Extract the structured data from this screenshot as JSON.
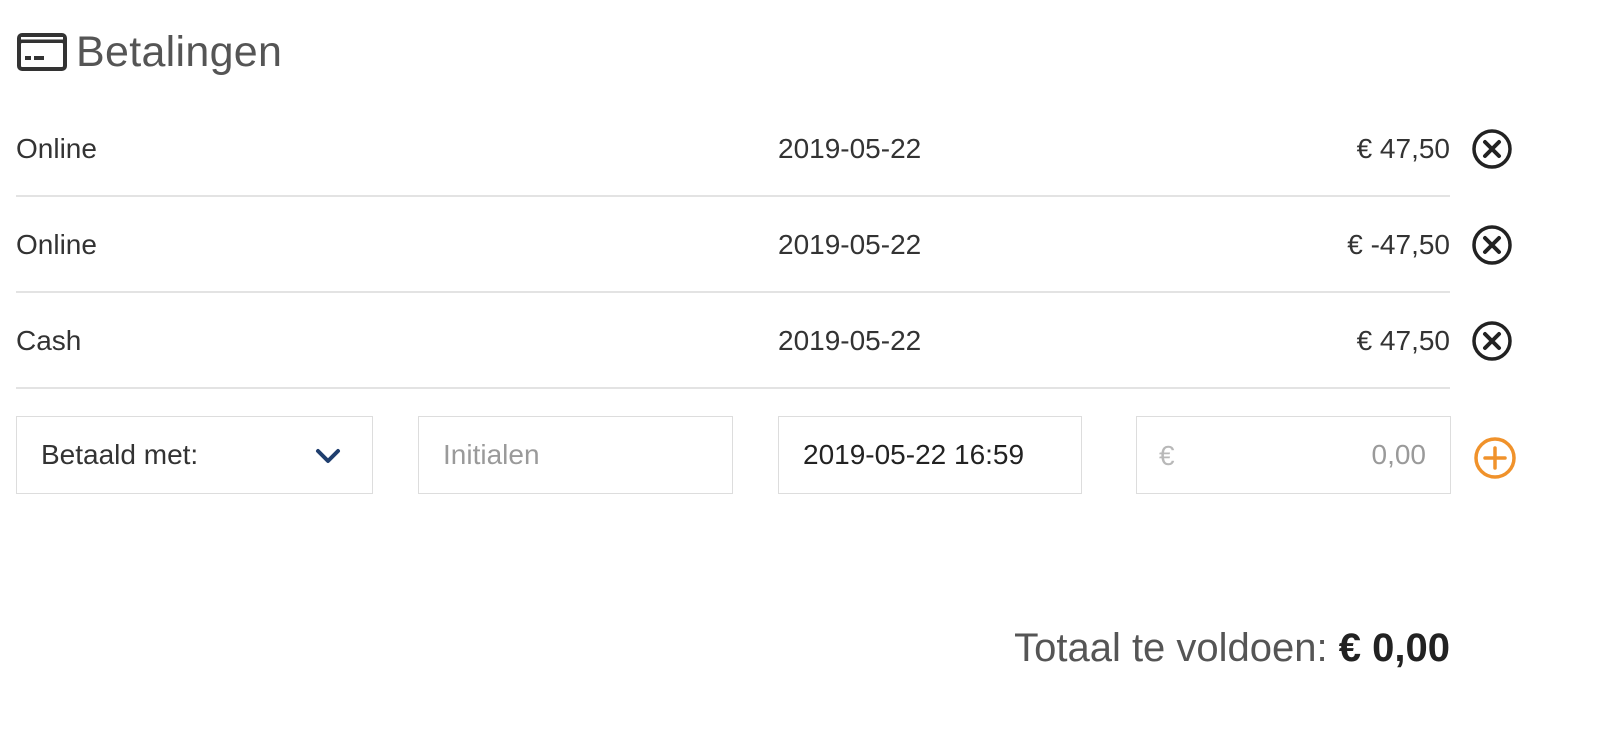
{
  "header": {
    "icon": "credit-card-icon",
    "title": "Betalingen"
  },
  "payments": [
    {
      "method": "Online",
      "date": "2019-05-22",
      "amount": "€ 47,50",
      "remove_icon": "close-circle-icon"
    },
    {
      "method": "Online",
      "date": "2019-05-22",
      "amount": "€ -47,50",
      "remove_icon": "close-circle-icon"
    },
    {
      "method": "Cash",
      "date": "2019-05-22",
      "amount": "€ 47,50",
      "remove_icon": "close-circle-icon"
    }
  ],
  "form": {
    "method_select": {
      "label": "Betaald met:",
      "icon": "chevron-down-icon"
    },
    "initials": {
      "placeholder": "Initialen",
      "value": ""
    },
    "datetime": {
      "value": "2019-05-22 16:59"
    },
    "amount": {
      "currency": "€",
      "placeholder": "0,00",
      "value": ""
    },
    "add_icon": "plus-circle-icon"
  },
  "total": {
    "label": "Totaal te voldoen:",
    "value": "€ 0,00"
  },
  "colors": {
    "divider": "#e3e3e3",
    "chevron": "#1f3e6e",
    "add_accent": "#f0922b",
    "icon_dark": "#222222"
  }
}
